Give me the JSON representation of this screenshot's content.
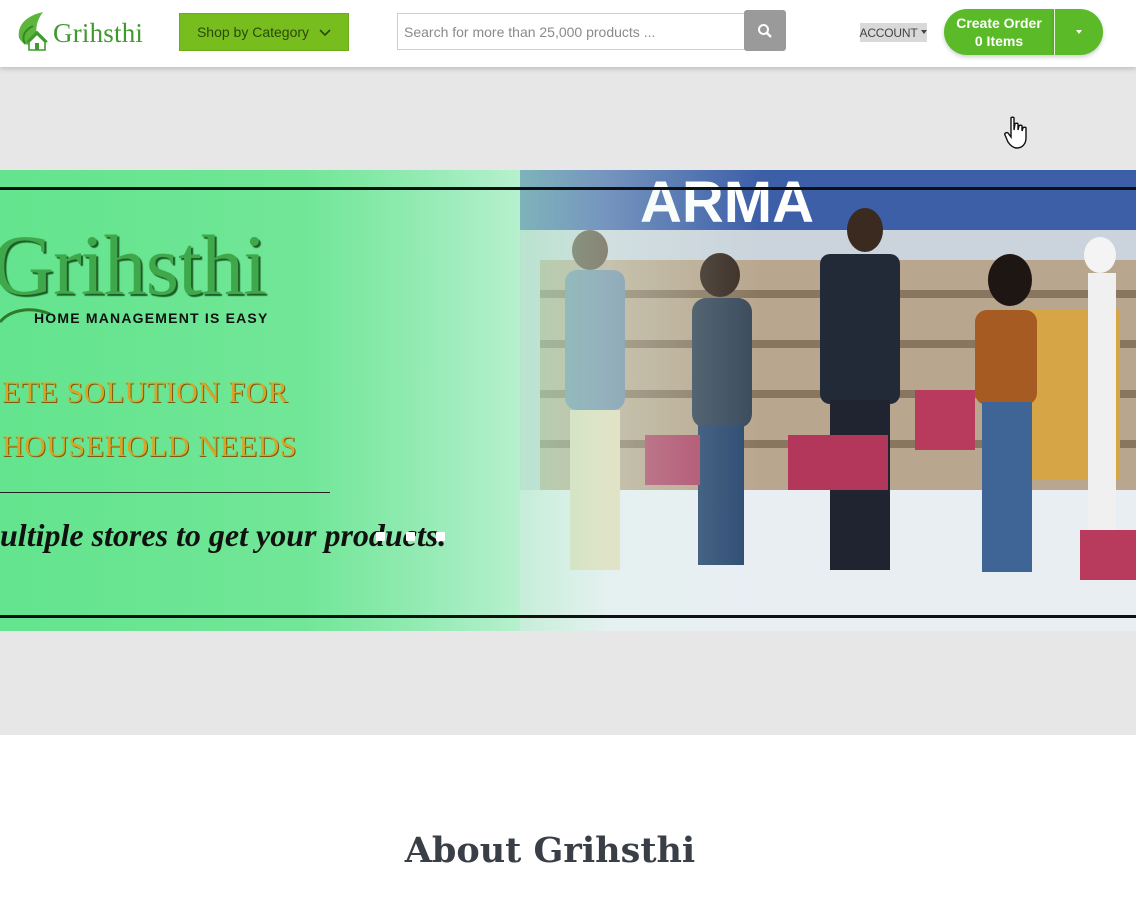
{
  "brand": {
    "name": "Grihsthi",
    "color": "#3f9a2e"
  },
  "header": {
    "category_label": "Shop by Category",
    "search_placeholder": "Search for more than 25,000 products ...",
    "account_label": "ACCOUNT",
    "order": {
      "line1": "Create Order",
      "line2": "0 Items"
    }
  },
  "banner": {
    "brand": "Grihsthi",
    "tagline": "HOME MANAGEMENT IS EASY",
    "line1": "ETE SOLUTION FOR",
    "line2": "HOUSEHOLD NEEDS",
    "line3": "ultiple stores to get your products.",
    "slides": 3
  },
  "about": {
    "title": "About Grihsthi"
  },
  "colors": {
    "accent_green": "#5bba28",
    "category_green": "#77bd1e",
    "search_button": "#9a9a9a"
  },
  "icons": [
    "leaf-house-logo-icon",
    "chevron-down-icon",
    "search-icon",
    "caret-down-icon",
    "hand-cursor-icon"
  ]
}
